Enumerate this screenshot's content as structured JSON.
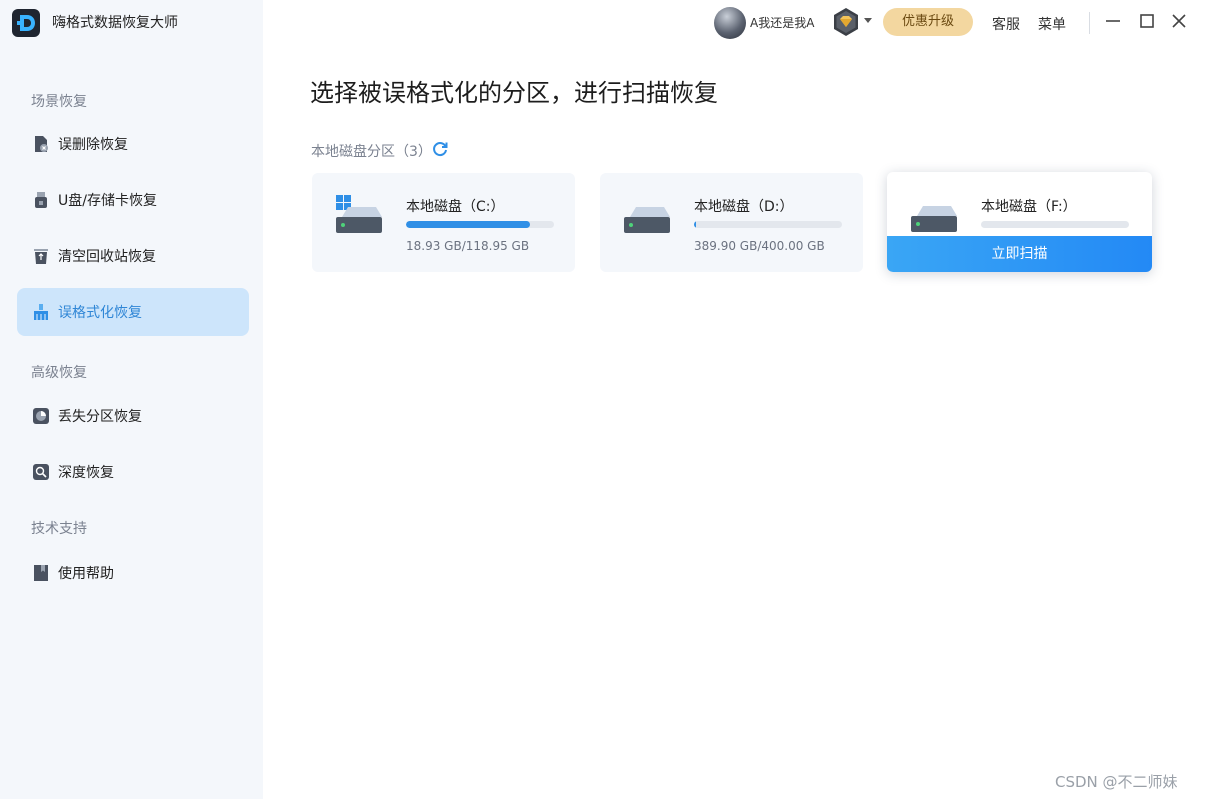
{
  "app": {
    "title": "嗨格式数据恢复大师"
  },
  "header": {
    "username": "A我还是我A",
    "upgrade_label": "优惠升级",
    "service_label": "客服",
    "menu_label": "菜单"
  },
  "sidebar": {
    "sections": [
      {
        "title": "场景恢复"
      },
      {
        "title": "高级恢复"
      },
      {
        "title": "技术支持"
      }
    ],
    "items": [
      {
        "label": "误删除恢复",
        "icon": "file-delete-icon"
      },
      {
        "label": "U盘/存储卡恢复",
        "icon": "usb-icon"
      },
      {
        "label": "清空回收站恢复",
        "icon": "recycle-bin-icon"
      },
      {
        "label": "误格式化恢复",
        "icon": "format-brush-icon",
        "active": true
      },
      {
        "label": "丢失分区恢复",
        "icon": "partition-icon"
      },
      {
        "label": "深度恢复",
        "icon": "deep-scan-icon"
      },
      {
        "label": "使用帮助",
        "icon": "help-book-icon"
      }
    ]
  },
  "main": {
    "title": "选择被误格式化的分区，进行扫描恢复",
    "partition_label": "本地磁盘分区（3）",
    "disks": [
      {
        "name": "本地磁盘（C:）",
        "size": "18.93 GB/118.95 GB",
        "used_fraction": 0.84,
        "system": true
      },
      {
        "name": "本地磁盘（D:）",
        "size": "389.90 GB/400.00 GB",
        "used_fraction": 0.015
      },
      {
        "name": "本地磁盘（F:）",
        "used_fraction": 0.0,
        "scan_label": "立即扫描"
      }
    ]
  },
  "watermark": "CSDN @不二师妹",
  "colors": {
    "accent": "#2f8fe6",
    "active_bg": "#cde5fb",
    "upgrade_bg": "#f3d7a0"
  }
}
